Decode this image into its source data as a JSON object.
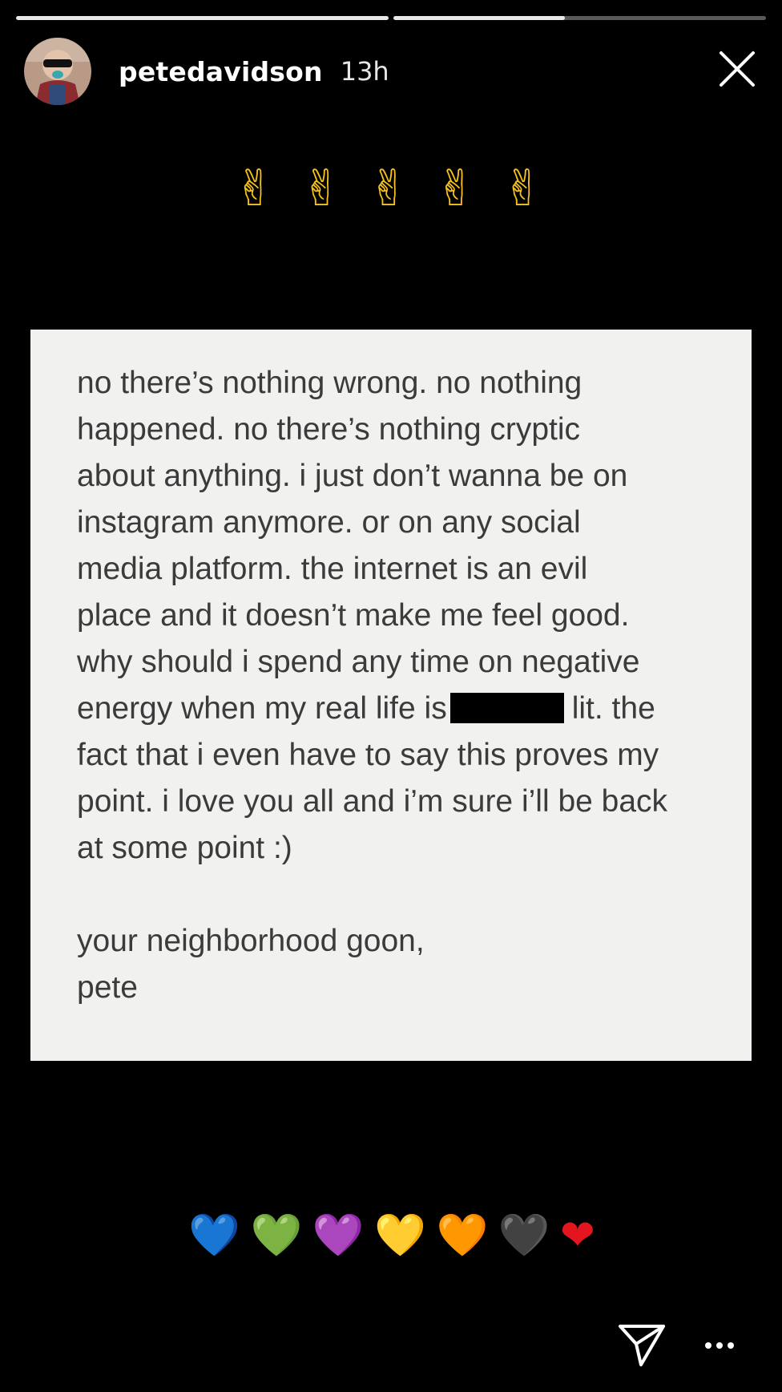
{
  "story": {
    "progress_segments": [
      1,
      0.46
    ],
    "username": "petedavidson",
    "timestamp": "13h"
  },
  "top_emojis": [
    "✌",
    "✌",
    "✌",
    "✌",
    "✌"
  ],
  "note": {
    "lines": [
      "no there’s nothing wrong. no nothing",
      "happened. no there’s nothing cryptic",
      "about anything. i just don’t wanna be on",
      "instagram anymore. or on any social",
      "media platform. the internet is an evil",
      "place and it doesn’t make me feel good.",
      "why should i spend any time on negative"
    ],
    "redacted_line_before": "energy when my real life is",
    "redacted_line_after": "lit. the",
    "lines_after": [
      "fact that i even have to say this proves my",
      "point. i love you all and i’m sure i’ll be back",
      "at some point :)"
    ],
    "signoff_lines": [
      "your neighborhood goon,",
      "pete"
    ]
  },
  "hearts": [
    {
      "emoji": "💙",
      "color": "#1f6ff2"
    },
    {
      "emoji": "💚",
      "color": "#25b43a"
    },
    {
      "emoji": "💜",
      "color": "#9b3ee0"
    },
    {
      "emoji": "💛",
      "color": "#f5c518"
    },
    {
      "emoji": "🧡",
      "color": "#f0860f"
    },
    {
      "emoji": "🖤",
      "color": "#1a1a1a"
    },
    {
      "emoji": "❤",
      "color": "#e3161f"
    }
  ],
  "icons": {
    "close": "close-icon",
    "send": "send-icon",
    "more": "more-icon"
  }
}
